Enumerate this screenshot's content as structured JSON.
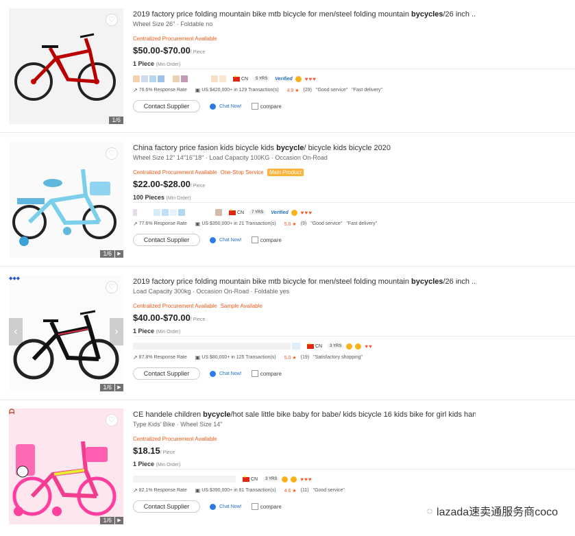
{
  "products": [
    {
      "title_prefix": "2019 factory price folding mountain bike mtb bicycle for men/steel folding mountain ",
      "title_keyword": "bycycles",
      "title_suffix": "/26 inch ...",
      "attributes": "Wheel Size 26\" · Foldable no",
      "tags": [
        "Centralized Procurement Available"
      ],
      "price": "$50.00-$70.00",
      "price_unit": "/ Piece",
      "moq": "1 Piece",
      "moq_unit": "(Min Order)",
      "country": "CN",
      "years": "5 YRS",
      "verified": "Verified",
      "response_rate": "76.6% Response Rate",
      "transactions": "US $420,000+ in 129 Transaction(s)",
      "rating": "4.9 ★",
      "reviews": "(29)",
      "quotes": [
        "\"Good service\"",
        "\"Fast delivery\""
      ],
      "contact": "Contact Supplier",
      "chat": "Chat Now!",
      "compare": "compare",
      "image_counter": "1/6"
    },
    {
      "title_prefix": "China factory price fasion kids bicycle kids ",
      "title_keyword": "bycycle",
      "title_suffix": "/ bicycle kids bicycle 2020",
      "attributes": "Wheel Size 12\" 14\"16\"18\" · Load Capacity 100KG · Occasion On-Road",
      "tags": [
        "Centralized Procurement Available",
        "One-Stop Service"
      ],
      "pill_tag": "Main Product",
      "price": "$22.00-$28.00",
      "price_unit": "/ Piece",
      "moq": "100 Pieces",
      "moq_unit": "(Min Order)",
      "country": "CN",
      "years": "7 YRS",
      "verified": "Verified",
      "response_rate": "77.6% Response Rate",
      "transactions": "US $350,000+ in 21 Transaction(s)",
      "rating": "5.0 ★",
      "reviews": "(9)",
      "quotes": [
        "\"Good service\"",
        "\"Fast delivery\""
      ],
      "contact": "Contact Supplier",
      "chat": "Chat Now!",
      "compare": "compare",
      "image_counter": "1/6"
    },
    {
      "title_prefix": "2019 factory price folding mountain bike mtb bicycle for men/steel folding mountain ",
      "title_keyword": "bycycles",
      "title_suffix": "/26 inch ...",
      "attributes": "Load Capacity 300kg · Occasion On-Road · Foldable yes",
      "tags": [
        "Centralized Procurement Available",
        "Sample Available"
      ],
      "price": "$40.00-$70.00",
      "price_unit": "/ Piece",
      "moq": "1 Piece",
      "moq_unit": "(Min Order)",
      "country": "CN",
      "years": "3 YRS",
      "response_rate": "87.8% Response Rate",
      "transactions": "US $80,000+ in 125 Transaction(s)",
      "rating": "5.0 ★",
      "reviews": "(19)",
      "quotes": [
        "\"Satisfactory shopping\""
      ],
      "contact": "Contact Supplier",
      "chat": "Chat Now!",
      "compare": "compare",
      "image_counter": "1/6"
    },
    {
      "title_prefix": "CE handele children ",
      "title_keyword": "bycycle",
      "title_suffix": "/hot sale little bike baby for babe/ kids bicycle 16 kids bike for girl kids han...",
      "attributes": "Type Kids' Bike · Wheel Size 14\"",
      "tags": [
        "Centralized Procurement Available"
      ],
      "price": "$18.15",
      "price_unit": "/ Piece",
      "moq": "1 Piece",
      "moq_unit": "(Min Order)",
      "country": "CN",
      "years": "3 YRS",
      "response_rate": "82.1% Response Rate",
      "transactions": "US $390,000+ in 81 Transaction(s)",
      "rating": "4.6 ★",
      "reviews": "(11)",
      "quotes": [
        "\"Good service\""
      ],
      "contact": "Contact Supplier",
      "chat": "Chat Now!",
      "compare": "compare",
      "image_counter": "1/6"
    }
  ],
  "watermark": "lazada速卖通服务商coco",
  "colors": {
    "accent_orange": "#f35a17",
    "link_blue": "#1f6ec8",
    "diamond": "#f25a2d"
  },
  "icons": [
    "heart-icon",
    "play-icon",
    "response-icon",
    "transaction-icon",
    "chat-icon",
    "medal-icon",
    "diamond-icon",
    "wechat-icon",
    "arrow-left-icon",
    "arrow-right-icon"
  ]
}
